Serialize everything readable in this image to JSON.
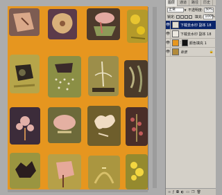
{
  "panel": {
    "tabs": [
      {
        "label": "图层"
      },
      {
        "label": "通道"
      },
      {
        "label": "路径"
      },
      {
        "label": "历史"
      }
    ],
    "blend_mode": "正常",
    "opacity_label": "不透明度:",
    "opacity_value": "30%",
    "lock_label": "锁定:",
    "fill_label": "填充:",
    "fill_value": "100%",
    "layers": [
      {
        "name": "下载去水印 副本 18",
        "selected": true
      },
      {
        "name": "下载去水印 副本 18",
        "selected": false
      },
      {
        "name": "颜色填充 1",
        "selected": false
      },
      {
        "name": "背景",
        "selected": false
      }
    ],
    "bottom_icons": [
      "link-icon",
      "fx-icon",
      "mask-icon",
      "adjustment-icon",
      "folder-icon",
      "new-layer-icon",
      "trash-icon"
    ]
  },
  "colors": {
    "canvas_bg": "#acacac",
    "artwork_bg": "#e6961f",
    "selection": "#0a246a"
  }
}
